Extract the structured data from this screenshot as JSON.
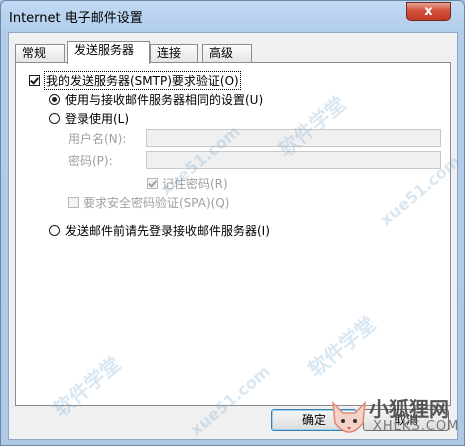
{
  "window": {
    "title": "Internet 电子邮件设置",
    "close_glyph": "x"
  },
  "tabs": [
    {
      "label": "常规",
      "active": false
    },
    {
      "label": "发送服务器",
      "active": true
    },
    {
      "label": "连接",
      "active": false
    },
    {
      "label": "高级",
      "active": false
    }
  ],
  "outgoing": {
    "smtp_auth": {
      "label": "我的发送服务器(SMTP)要求验证(O)",
      "checked": true
    },
    "use_same": {
      "label": "使用与接收邮件服务器相同的设置(U)",
      "checked": true
    },
    "login_using": {
      "label": "登录使用(L)",
      "checked": false
    },
    "username": {
      "label": "用户名(N):",
      "value": ""
    },
    "password": {
      "label": "密码(P):",
      "value": ""
    },
    "remember_password": {
      "label": "记住密码(R)",
      "checked": true
    },
    "require_spa": {
      "label": "要求安全密码验证(SPA)(Q)",
      "checked": false
    },
    "log_on_first": {
      "label": "发送邮件前请先登录接收邮件服务器(I)",
      "checked": false
    }
  },
  "buttons": {
    "ok": "确定",
    "cancel": "取消"
  },
  "watermark": {
    "text1": "软件学堂",
    "text2": "xue51.com",
    "logo_text": "小狐狸网",
    "logo_sub": "XHLKS.COM"
  }
}
